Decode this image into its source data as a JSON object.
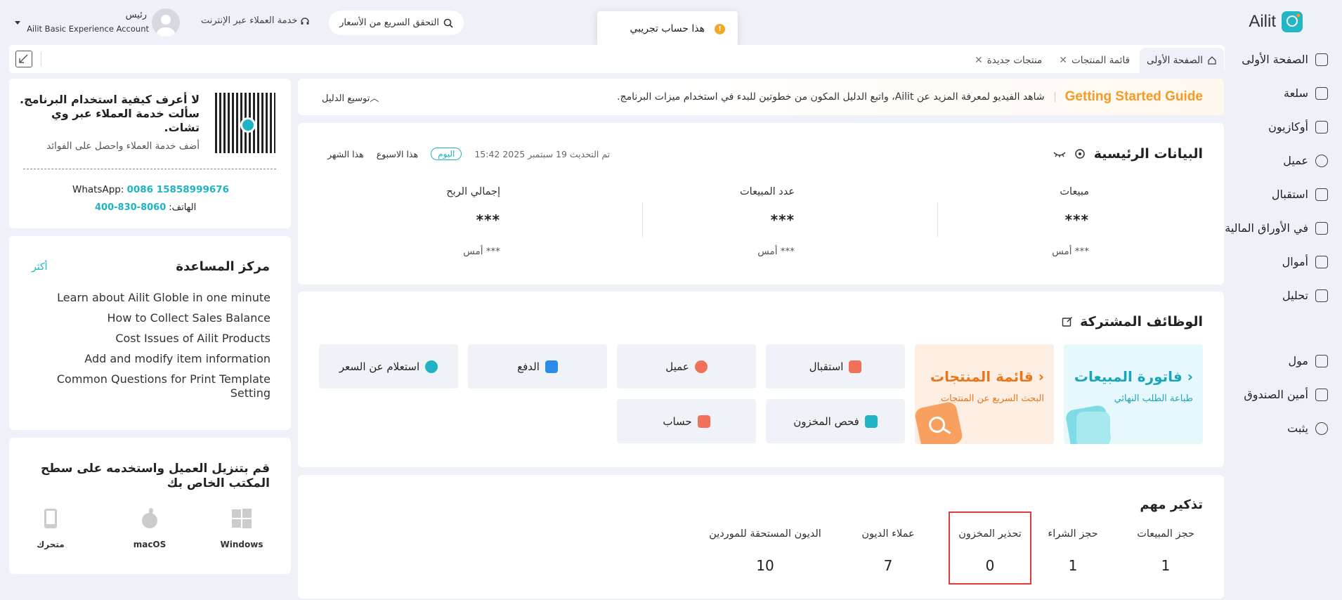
{
  "app": {
    "name": "Ailit"
  },
  "topbar": {
    "price_check": "التحقق السريع من الأسعار",
    "online_service": "خدمة العملاء عبر الإنترنت",
    "user_role": "رئيس",
    "account": "Ailit Basic Experience Account"
  },
  "toast": {
    "message": "هذا حساب تجريبي",
    "icon": "!"
  },
  "sidebar": {
    "items": [
      {
        "label": "الصفحة الأولى",
        "icon": "home-icon"
      },
      {
        "label": "سلعة",
        "icon": "goods-icon"
      },
      {
        "label": "أوكازيون",
        "icon": "sale-icon"
      },
      {
        "label": "عميل",
        "icon": "user-icon"
      },
      {
        "label": "استقبال",
        "icon": "inbound-icon"
      },
      {
        "label": "في الأوراق المالية",
        "icon": "stock-icon"
      },
      {
        "label": "أموال",
        "icon": "funds-icon"
      },
      {
        "label": "تحليل",
        "icon": "analysis-icon"
      },
      {
        "label": "مول",
        "icon": "mall-icon"
      },
      {
        "label": "أمين الصندوق",
        "icon": "cashier-icon"
      },
      {
        "label": "يثبت",
        "icon": "settings-icon"
      }
    ]
  },
  "tabs": [
    {
      "label": "الصفحة الأولى",
      "active": true
    },
    {
      "label": "قائمة المنتجات",
      "active": false
    },
    {
      "label": "منتجات جديدة",
      "active": false
    }
  ],
  "guide": {
    "title": "Getting Started Guide",
    "description": "شاهد الفيديو لمعرفة المزيد عن Ailit، واتبع الدليل المكون من خطوتين للبدء في استخدام ميزات البرنامج.",
    "expand": "توسيع الدليل"
  },
  "main_data": {
    "title": "البيانات الرئيسية",
    "updated": "تم التحديث 19 سبتمبر 2025 15:42",
    "filters": [
      "اليوم",
      "هذا الاسبوع",
      "هذا الشهر"
    ],
    "metrics": [
      {
        "label": "مبيعات",
        "value": "***",
        "prev": "أمس ***"
      },
      {
        "label": "عدد المبيعات",
        "value": "***",
        "prev": "أمس ***"
      },
      {
        "label": "إجمالي الربح",
        "value": "***",
        "prev": "أمس ***"
      }
    ]
  },
  "common": {
    "title": "الوظائف المشتركة",
    "tiles": [
      {
        "title": "فاتورة المبيعات ›",
        "sub": "طباعة الطلب النهائي",
        "color": "#1aa6b8",
        "bg": "#e6f8fb"
      },
      {
        "title": "قائمة المنتجات ›",
        "sub": "البحث السريع عن المنتجات",
        "color": "#e8761a",
        "bg": "#fdeee4"
      }
    ],
    "buttons": [
      {
        "label": "استقبال",
        "icon": "inbound-icon",
        "color": "#f0705a"
      },
      {
        "label": "عميل",
        "icon": "customer-icon",
        "color": "#f0705a"
      },
      {
        "label": "الدفع",
        "icon": "payment-icon",
        "color": "#2a8be8"
      },
      {
        "label": "استعلام عن السعر",
        "icon": "price-query-icon",
        "color": "#1fb4c4"
      },
      {
        "label": "فحص المخزون",
        "icon": "inventory-icon",
        "color": "#1fb4c4"
      },
      {
        "label": "حساب",
        "icon": "account-icon",
        "color": "#f0705a"
      }
    ]
  },
  "reminders": {
    "title": "تذكير مهم",
    "items": [
      {
        "label": "حجز المبيعات",
        "value": "1"
      },
      {
        "label": "حجز الشراء",
        "value": "1"
      },
      {
        "label": "تحذير المخزون",
        "value": "0",
        "highlight": true
      },
      {
        "label": "عملاء الديون",
        "value": "7"
      },
      {
        "label": "الديون المستحقة للموردين",
        "value": "10"
      }
    ]
  },
  "service_panel": {
    "line1": "لا أعرف كيفية استخدام البرنامج.",
    "line2": "سألت خدمة العملاء عبر وي",
    "line3": "تشات.",
    "hint": "أضف خدمة العملاء واحصل على الفوائد",
    "whatsapp_label": "WhatsApp:",
    "whatsapp_value": "0086 15858999676",
    "phone_label": "الهاتف:",
    "phone_value": "400-830-8060"
  },
  "help_center": {
    "title": "مركز المساعدة",
    "more": "أكثر",
    "links": [
      "Learn about Ailit Globle in one minute",
      "How to Collect Sales Balance",
      "Cost Issues of Ailit Products",
      "Add and modify item information",
      "Common Questions for Print Template Setting"
    ]
  },
  "download": {
    "title": "قم بتنزيل العميل واستخدمه على سطح المكتب الخاص بك",
    "platforms": [
      {
        "label": "Windows",
        "icon": "windows-icon"
      },
      {
        "label": "macOS",
        "icon": "apple-icon"
      },
      {
        "label": "متحرك",
        "icon": "mobile-icon"
      }
    ]
  }
}
